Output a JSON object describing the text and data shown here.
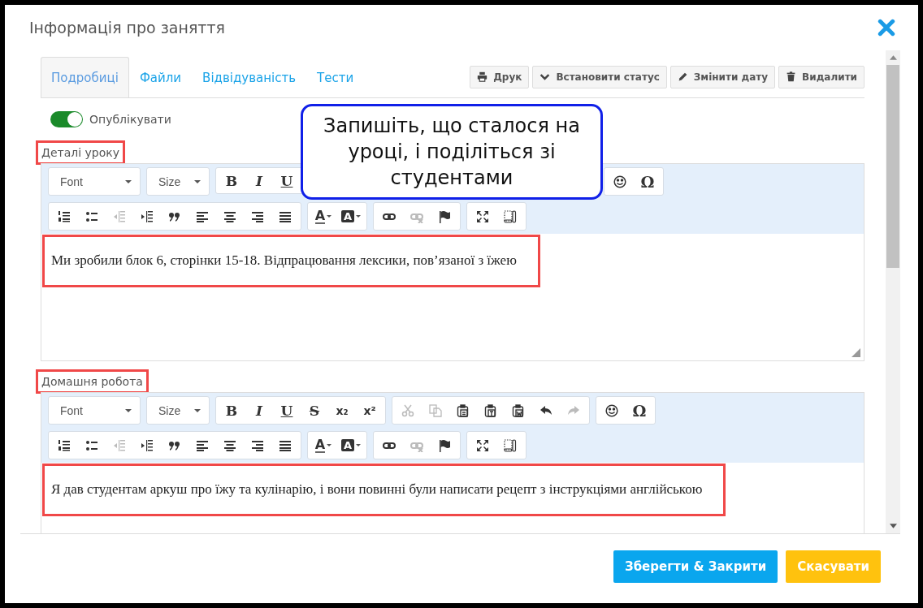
{
  "dialog": {
    "title": "Інформація про заняття"
  },
  "tabs": [
    {
      "label": "Подробиці",
      "selected": true
    },
    {
      "label": "Файли",
      "selected": false
    },
    {
      "label": "Відвідуваність",
      "selected": false
    },
    {
      "label": "Тести",
      "selected": false
    }
  ],
  "actions": [
    {
      "kind": "print",
      "label": "Друк"
    },
    {
      "kind": "status",
      "label": "Встановити статус"
    },
    {
      "kind": "edit-date",
      "label": "Змінити дату"
    },
    {
      "kind": "delete",
      "label": "Видалити"
    }
  ],
  "publish": {
    "label": "Опублікувати",
    "on": true
  },
  "callout": {
    "text": "Запишіть, що сталося на уроці, і поділіться зі студентами"
  },
  "editors": [
    {
      "label": "Деталі уроку",
      "highlighted": true,
      "resizable": true,
      "content": "Ми зробили блок 6, сторінки 15-18. Відпрацювання лексики, пов’язаної з їжею",
      "content_highlighted": true,
      "toolbar": [
        [
          {
            "clipped": false,
            "items": [
              {
                "kind": "select",
                "label": "Font",
                "disabled": false
              }
            ]
          },
          {
            "clipped": false,
            "items": [
              {
                "kind": "select",
                "label": "Size",
                "disabled": false
              }
            ]
          },
          {
            "clipped": true,
            "items": [
              {
                "kind": "bold",
                "glyph": "B",
                "disabled": false
              },
              {
                "kind": "italic",
                "glyph": "I",
                "disabled": false
              },
              {
                "kind": "underline",
                "glyph": "U",
                "disabled": false
              }
            ]
          },
          {
            "clipped": false,
            "items": [
              {
                "kind": "emoji",
                "disabled": false
              },
              {
                "kind": "omega",
                "glyph": "Ω",
                "disabled": false
              }
            ]
          }
        ],
        [
          {
            "clipped": false,
            "items": [
              {
                "kind": "ordered-list",
                "disabled": false
              },
              {
                "kind": "bullet-list",
                "disabled": false
              },
              {
                "kind": "outdent",
                "disabled": true
              },
              {
                "kind": "indent",
                "disabled": false
              },
              {
                "kind": "quote",
                "disabled": false
              },
              {
                "kind": "align-left",
                "disabled": false
              },
              {
                "kind": "align-center",
                "disabled": false
              },
              {
                "kind": "align-right",
                "disabled": false
              },
              {
                "kind": "justify",
                "disabled": false
              }
            ]
          },
          {
            "clipped": false,
            "items": [
              {
                "kind": "text-color",
                "glyph": "A",
                "disabled": false
              },
              {
                "kind": "bg-color",
                "glyph": "A",
                "disabled": false
              }
            ]
          },
          {
            "clipped": false,
            "items": [
              {
                "kind": "link",
                "disabled": false
              },
              {
                "kind": "unlink",
                "disabled": true
              },
              {
                "kind": "anchor",
                "disabled": false
              }
            ]
          },
          {
            "clipped": false,
            "items": [
              {
                "kind": "maximize",
                "disabled": false
              },
              {
                "kind": "show-blocks",
                "disabled": false
              }
            ]
          }
        ]
      ]
    },
    {
      "label": "Домашня робота",
      "highlighted": true,
      "resizable": false,
      "content": "Я дав студентам аркуш про їжу та кулінарію, і вони повинні були написати рецепт з інструкціями англійською",
      "content_highlighted": true,
      "toolbar": [
        [
          {
            "clipped": false,
            "items": [
              {
                "kind": "select",
                "label": "Font",
                "disabled": false
              }
            ]
          },
          {
            "clipped": false,
            "items": [
              {
                "kind": "select",
                "label": "Size",
                "disabled": false
              }
            ]
          },
          {
            "clipped": false,
            "items": [
              {
                "kind": "bold",
                "glyph": "B",
                "disabled": false
              },
              {
                "kind": "italic",
                "glyph": "I",
                "disabled": false
              },
              {
                "kind": "underline",
                "glyph": "U",
                "disabled": false
              },
              {
                "kind": "strike",
                "glyph": "S",
                "disabled": false
              },
              {
                "kind": "subscript",
                "glyph": "x₂",
                "disabled": false
              },
              {
                "kind": "superscript",
                "glyph": "x²",
                "disabled": false
              }
            ]
          },
          {
            "clipped": false,
            "items": [
              {
                "kind": "cut",
                "disabled": true
              },
              {
                "kind": "copy",
                "disabled": true
              },
              {
                "kind": "paste",
                "disabled": false
              },
              {
                "kind": "paste-text",
                "disabled": false
              },
              {
                "kind": "paste-word",
                "disabled": false
              },
              {
                "kind": "undo",
                "disabled": false
              },
              {
                "kind": "redo",
                "disabled": true
              }
            ]
          },
          {
            "clipped": false,
            "items": [
              {
                "kind": "emoji",
                "disabled": false
              },
              {
                "kind": "omega",
                "glyph": "Ω",
                "disabled": false
              }
            ]
          }
        ],
        [
          {
            "clipped": false,
            "items": [
              {
                "kind": "ordered-list",
                "disabled": false
              },
              {
                "kind": "bullet-list",
                "disabled": false
              },
              {
                "kind": "outdent",
                "disabled": true
              },
              {
                "kind": "indent",
                "disabled": false
              },
              {
                "kind": "quote",
                "disabled": false
              },
              {
                "kind": "align-left",
                "disabled": false
              },
              {
                "kind": "align-center",
                "disabled": false
              },
              {
                "kind": "align-right",
                "disabled": false
              },
              {
                "kind": "justify",
                "disabled": false
              }
            ]
          },
          {
            "clipped": false,
            "items": [
              {
                "kind": "text-color",
                "glyph": "A",
                "disabled": false
              },
              {
                "kind": "bg-color",
                "glyph": "A",
                "disabled": false
              }
            ]
          },
          {
            "clipped": false,
            "items": [
              {
                "kind": "link",
                "disabled": false
              },
              {
                "kind": "unlink",
                "disabled": true
              },
              {
                "kind": "anchor",
                "disabled": false
              }
            ]
          },
          {
            "clipped": false,
            "items": [
              {
                "kind": "maximize",
                "disabled": false
              },
              {
                "kind": "show-blocks",
                "disabled": false
              }
            ]
          }
        ]
      ]
    }
  ],
  "footer_buttons": [
    {
      "kind": "primary",
      "label": "Зберегти & Закрити"
    },
    {
      "kind": "warning",
      "label": "Скасувати"
    }
  ]
}
